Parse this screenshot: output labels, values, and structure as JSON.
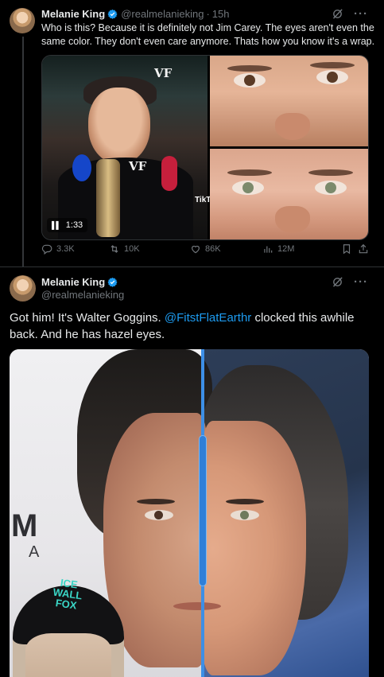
{
  "tweet1": {
    "author_name": "Melanie King",
    "handle": "@realmelanieking",
    "separator": "·",
    "time": "15h",
    "text": "Who is this? Because it is definitely not Jim Carey. The eyes aren't even the same color. They don't even care anymore. Thats how you know it's a wrap.",
    "video": {
      "duration": "1:33",
      "logo_top": "VF",
      "logo_mic": "VF",
      "platform": "TikTok"
    },
    "actions": {
      "replies": "3.3K",
      "reposts": "10K",
      "likes": "86K",
      "views": "12M"
    }
  },
  "tweet2": {
    "author_name": "Melanie King",
    "handle": "@realmelanieking",
    "text_before": "Got him! It's Walter Goggins. ",
    "mention": "@FitstFlatEarthr",
    "text_after": " clocked this awhile back. And he has hazel eyes.",
    "image": {
      "sign_letter": "M",
      "sign_letter2": "A",
      "cap_line1": "ICE",
      "cap_line2": "WALL",
      "cap_line3": "FOX"
    }
  },
  "icons": {
    "verified": "verified-badge-icon",
    "grok": "grok-icon",
    "more": "more-icon",
    "reply": "reply-icon",
    "repost": "repost-icon",
    "like": "heart-icon",
    "views": "views-icon",
    "bookmark": "bookmark-icon",
    "share": "share-icon"
  },
  "colors": {
    "background": "#000000",
    "text": "#e7e9ea",
    "secondary_text": "#71767b",
    "accent": "#1d9bf0",
    "divider": "#2f3336"
  }
}
